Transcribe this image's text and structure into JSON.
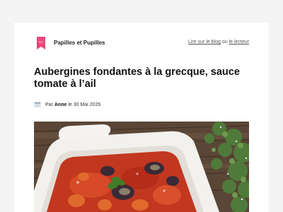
{
  "header": {
    "brand_name": "Papilles et Pupilles",
    "logo_text": "PLP",
    "read_blog_link": "Lire sur le blog",
    "or_text": "ou",
    "read_reader_link": "le lecteur"
  },
  "article": {
    "title": "Aubergines fondantes à la grecque, sauce tomate à l’ail",
    "byline_prefix": "Par",
    "author": "Anne",
    "date_text": "le 30 Mai 2026"
  },
  "colors": {
    "brand_pink": "#e8477a",
    "background": "#f4f4f4",
    "card": "#ffffff"
  }
}
